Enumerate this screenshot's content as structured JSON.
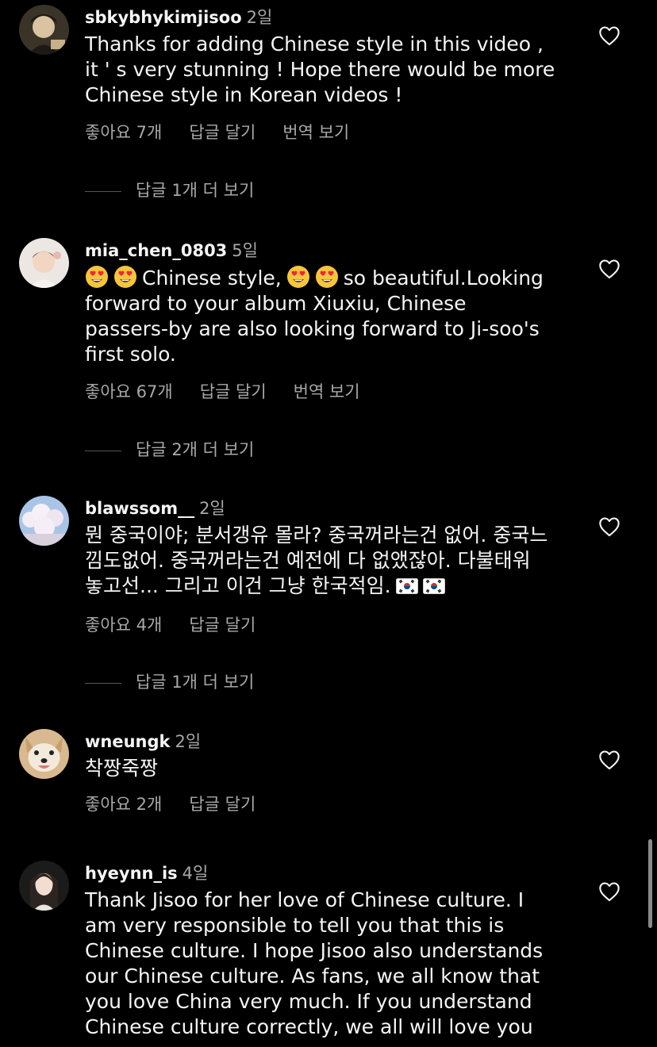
{
  "comments": [
    {
      "username": "sbkybhykimjisoo",
      "time": "2일",
      "text": "Thanks for adding Chinese style in this video ,\nit ' s very stunning ! Hope there would be more\nChinese style in Korean videos !",
      "likes": "좋아요 7개",
      "reply": "답글 달기",
      "translate": "번역 보기",
      "more_replies": "답글 1개 더 보기"
    },
    {
      "username": "mia_chen_0803",
      "time": "5일",
      "text_part1": "Chinese style,",
      "text_part2": "so beautiful.Looking\nforward to your album Xiuxiu, Chinese\npassers-by are also looking forward to Ji-soo's\nfirst solo.",
      "likes": "좋아요 67개",
      "reply": "답글 달기",
      "translate": "번역 보기",
      "more_replies": "답글 2개 더 보기"
    },
    {
      "username": "blawssom__",
      "time": "2일",
      "text": "뭔 중국이야; 분서갱유 몰라? 중국꺼라는건 없어. 중국느\n낌도없어. 중국꺼라는건 예전에 다 없앴잖아. 다불태워\n놓고선... 그리고 이건 그냥 한국적임.",
      "likes": "좋아요 4개",
      "reply": "답글 달기",
      "more_replies": "답글 1개 더 보기"
    },
    {
      "username": "wneungk",
      "time": "2일",
      "text": "착짱죽짱",
      "likes": "좋아요 2개",
      "reply": "답글 달기"
    },
    {
      "username": "hyeynn_is",
      "time": "4일",
      "text": "Thank Jisoo for her love of Chinese culture. I\nam very responsible to tell you that this is\nChinese culture. I hope Jisoo also understands\nour Chinese culture. As fans, we all know that\nyou love China very much. If you understand\nChinese culture correctly, we all will love you"
    }
  ],
  "icons": {
    "heart": "heart-outline-icon",
    "heart_eyes": "heart-eyes-emoji",
    "flag": "south-korea-flag"
  },
  "colors": {
    "background": "#000000",
    "primary_text": "#f5f5f5",
    "secondary_text": "#a8a8a8"
  }
}
